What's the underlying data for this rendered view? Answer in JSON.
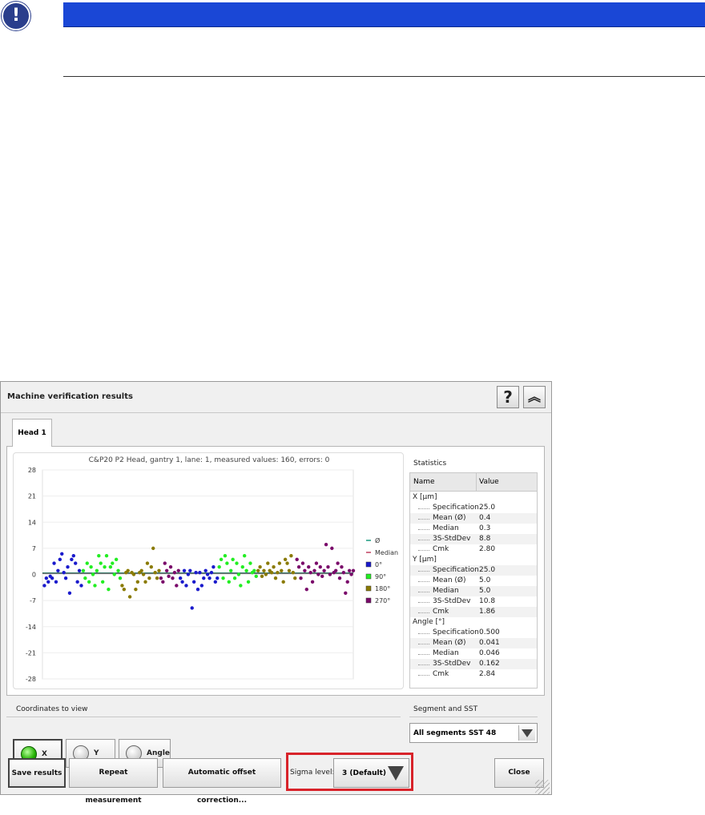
{
  "notice": {
    "icon": "exclamation-icon",
    "icon_glyph": "!"
  },
  "window": {
    "title": "Machine verification results",
    "help_glyph": "?",
    "collapse_glyph": "︽"
  },
  "tabs": [
    {
      "label": "Head 1"
    }
  ],
  "chart_data": {
    "type": "scatter",
    "title": "C&P20 P2 Head, gantry 1, lane: 1, measured values: 160, errors: 0",
    "xlabel": "",
    "ylabel": "",
    "ylim": [
      -28,
      28
    ],
    "yticks": [
      28,
      21,
      14,
      7,
      0,
      -7,
      -14,
      -21,
      -28
    ],
    "xlim": [
      0,
      160
    ],
    "legend_position": "right",
    "legend": [
      {
        "name": "Ø",
        "color": "#1a9a80",
        "marker": "line"
      },
      {
        "name": "Median",
        "color": "#c04060",
        "marker": "line"
      },
      {
        "name": "0°",
        "color": "#1a1acc",
        "marker": "square"
      },
      {
        "name": "90°",
        "color": "#22ee22",
        "marker": "square"
      },
      {
        "name": "180°",
        "color": "#8a7a00",
        "marker": "square"
      },
      {
        "name": "270°",
        "color": "#7a0a6a",
        "marker": "square"
      }
    ],
    "reference_lines": {
      "mean": 0.4,
      "median": 0.3
    },
    "series": [
      {
        "name": "0°",
        "color": "#1a1acc",
        "x": [
          1,
          2,
          3,
          4,
          5,
          6,
          7,
          8,
          9,
          10,
          11,
          12,
          13,
          14,
          15,
          16,
          17,
          18,
          19,
          20,
          71,
          72,
          73,
          74,
          75,
          76,
          77,
          78,
          79,
          80,
          81,
          82,
          83,
          84,
          85,
          86,
          87,
          88,
          89,
          90
        ],
        "y": [
          -3,
          -1,
          -2,
          -0.5,
          -1,
          3,
          -2,
          1,
          4,
          5.5,
          0.5,
          -1,
          2,
          -5,
          4,
          5,
          3,
          -2,
          1,
          -3,
          -1,
          -2,
          1,
          -3,
          0,
          1,
          -9,
          -2,
          0.5,
          -4,
          0.5,
          -3,
          -1,
          1,
          0,
          -1,
          0.5,
          2,
          -2,
          -1
        ]
      },
      {
        "name": "90°",
        "color": "#22ee22",
        "x": [
          21,
          22,
          23,
          24,
          25,
          26,
          27,
          28,
          29,
          30,
          31,
          32,
          33,
          34,
          35,
          36,
          37,
          38,
          39,
          40,
          91,
          92,
          93,
          94,
          95,
          96,
          97,
          98,
          99,
          100,
          101,
          102,
          103,
          104,
          105,
          106,
          107,
          108,
          109,
          110
        ],
        "y": [
          1,
          -1,
          3,
          -2,
          2,
          0,
          -3,
          1,
          5,
          3,
          -2,
          2,
          5,
          -4,
          2,
          3,
          0,
          4,
          1,
          -1,
          2,
          4,
          -1,
          5,
          3,
          -2,
          1,
          4,
          -1,
          3,
          0,
          -3,
          2,
          5,
          1,
          -2,
          3,
          0.5,
          1,
          -0.5
        ]
      },
      {
        "name": "180°",
        "color": "#8a7a00",
        "x": [
          41,
          42,
          43,
          44,
          45,
          46,
          47,
          48,
          49,
          50,
          51,
          52,
          53,
          54,
          55,
          56,
          57,
          58,
          59,
          60,
          111,
          112,
          113,
          114,
          115,
          116,
          117,
          118,
          119,
          120,
          121,
          122,
          123,
          124,
          125,
          126,
          127,
          128,
          129,
          130
        ],
        "y": [
          -3,
          -4,
          0.5,
          1,
          -6,
          0.5,
          0,
          -4,
          -2,
          0.5,
          1,
          0,
          -2,
          3,
          -1,
          2,
          7,
          0.5,
          -1,
          1,
          1,
          2,
          -0.5,
          1,
          0,
          3,
          1,
          0.5,
          2,
          -1,
          0.5,
          3,
          1,
          -2,
          4,
          3,
          1,
          5,
          0.5,
          -1
        ]
      },
      {
        "name": "270°",
        "color": "#7a0a6a",
        "x": [
          61,
          62,
          63,
          64,
          65,
          66,
          67,
          68,
          69,
          70,
          131,
          132,
          133,
          134,
          135,
          136,
          137,
          138,
          139,
          140,
          141,
          142,
          143,
          144,
          145,
          146,
          147,
          148,
          149,
          150,
          151,
          152,
          153,
          154,
          155,
          156,
          157,
          158,
          159,
          160
        ],
        "y": [
          -1,
          -2,
          3,
          1,
          -0.5,
          2,
          -1,
          0.5,
          -3,
          1,
          4,
          2,
          -1,
          3,
          1,
          -4,
          2,
          0.5,
          -2,
          1,
          3,
          0,
          2,
          -0.5,
          1,
          8,
          2,
          0,
          7,
          0.5,
          1,
          3,
          -1,
          2,
          0.5,
          -5,
          -2,
          1,
          0,
          1
        ]
      }
    ]
  },
  "statistics": {
    "heading": "Statistics",
    "columns": [
      "Name",
      "Value"
    ],
    "groups": [
      {
        "label": "X [µm]",
        "rows": [
          {
            "name": "Specification",
            "value": "25.0"
          },
          {
            "name": "Mean (Ø)",
            "value": "0.4"
          },
          {
            "name": "Median",
            "value": "0.3"
          },
          {
            "name": "3S-StdDev",
            "value": "8.8"
          },
          {
            "name": "Cmk",
            "value": "2.80"
          }
        ]
      },
      {
        "label": "Y [µm]",
        "rows": [
          {
            "name": "Specification",
            "value": "25.0"
          },
          {
            "name": "Mean (Ø)",
            "value": "5.0"
          },
          {
            "name": "Median",
            "value": "5.0"
          },
          {
            "name": "3S-StdDev",
            "value": "10.8"
          },
          {
            "name": "Cmk",
            "value": "1.86"
          }
        ]
      },
      {
        "label": "Angle [°]",
        "rows": [
          {
            "name": "Specification",
            "value": "0.500"
          },
          {
            "name": "Mean (Ø)",
            "value": "0.041"
          },
          {
            "name": "Median",
            "value": "0.046"
          },
          {
            "name": "3S-StdDev",
            "value": "0.162"
          },
          {
            "name": "Cmk",
            "value": "2.84"
          }
        ]
      }
    ]
  },
  "coordinates": {
    "label": "Coordinates to view",
    "options": [
      {
        "label": "X",
        "selected": true
      },
      {
        "label": "Y",
        "selected": false
      },
      {
        "label": "Angle",
        "selected": false
      }
    ]
  },
  "segment": {
    "label": "Segment and SST",
    "selected": "All segments SST 48"
  },
  "buttons": {
    "save": "Save results",
    "repeat": "Repeat measurement",
    "auto_offset": "Automatic offset correction...",
    "close": "Close"
  },
  "sigma": {
    "label": "Sigma level:",
    "selected": "3 (Default)",
    "highlight_color": "#d8232a"
  }
}
